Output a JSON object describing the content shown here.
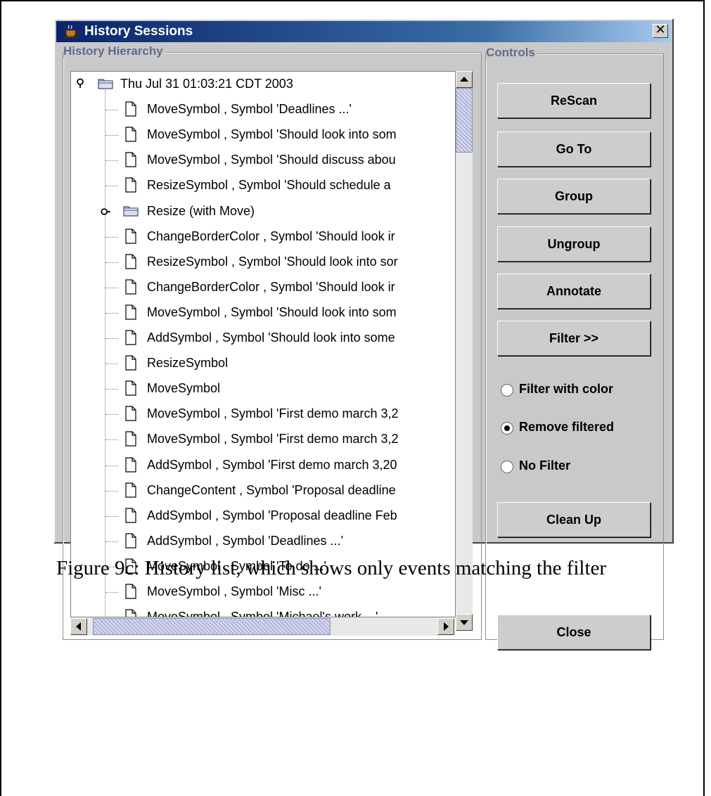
{
  "window": {
    "title": "History Sessions",
    "close_glyph": "✕"
  },
  "history": {
    "group_label": "History Hierarchy",
    "session_label": "Thu Jul 31 01:03:21 CDT 2003",
    "items": [
      {
        "label": "MoveSymbol , Symbol 'Deadlines ...'",
        "type": "doc",
        "level": 1
      },
      {
        "label": "MoveSymbol , Symbol 'Should look into som",
        "type": "doc",
        "level": 1
      },
      {
        "label": "MoveSymbol , Symbol 'Should discuss abou",
        "type": "doc",
        "level": 1
      },
      {
        "label": "ResizeSymbol , Symbol 'Should schedule a",
        "type": "doc",
        "level": 1
      },
      {
        "label": "Resize (with Move)",
        "type": "folder",
        "level": 1
      },
      {
        "label": "ChangeBorderColor , Symbol 'Should look ir",
        "type": "doc",
        "level": 1
      },
      {
        "label": "ResizeSymbol , Symbol 'Should look into sor",
        "type": "doc",
        "level": 1
      },
      {
        "label": "ChangeBorderColor , Symbol 'Should look ir",
        "type": "doc",
        "level": 1
      },
      {
        "label": "MoveSymbol , Symbol 'Should look into som",
        "type": "doc",
        "level": 1
      },
      {
        "label": "AddSymbol , Symbol 'Should look into some",
        "type": "doc",
        "level": 1
      },
      {
        "label": "ResizeSymbol",
        "type": "doc",
        "level": 1
      },
      {
        "label": "MoveSymbol",
        "type": "doc",
        "level": 1
      },
      {
        "label": "MoveSymbol , Symbol 'First demo march 3,2",
        "type": "doc",
        "level": 1
      },
      {
        "label": "MoveSymbol , Symbol 'First demo march 3,2",
        "type": "doc",
        "level": 1
      },
      {
        "label": "AddSymbol , Symbol 'First demo march 3,20",
        "type": "doc",
        "level": 1
      },
      {
        "label": "ChangeContent , Symbol 'Proposal deadline",
        "type": "doc",
        "level": 1
      },
      {
        "label": "AddSymbol , Symbol 'Proposal deadline Feb",
        "type": "doc",
        "level": 1
      },
      {
        "label": "AddSymbol , Symbol 'Deadlines ...'",
        "type": "doc",
        "level": 1
      },
      {
        "label": "MoveSymbol , Symbol 'To do ...'",
        "type": "doc",
        "level": 1
      },
      {
        "label": "MoveSymbol , Symbol 'Misc ...'",
        "type": "doc",
        "level": 1
      },
      {
        "label": "MoveSymbol , Symbol 'Michael's work ...'",
        "type": "doc",
        "level": 1
      }
    ]
  },
  "controls": {
    "group_label": "Controls",
    "buttons": {
      "rescan": "ReScan",
      "goto": "Go To",
      "group": "Group",
      "ungroup": "Ungroup",
      "annotate": "Annotate",
      "filter": "Filter >>",
      "cleanup": "Clean Up",
      "close": "Close"
    },
    "radios": {
      "filter_color": "Filter with color",
      "remove_filtered": "Remove filtered",
      "no_filter": "No Filter",
      "selected": "remove_filtered"
    }
  },
  "caption": "Figure 9c: History list, which shows only events matching the filter",
  "icons": {
    "title": "coffee-cup-icon",
    "tree_doc": "document-icon",
    "tree_folder": "folder-icon",
    "tree_handle": "tree-expand-handle-icon"
  }
}
